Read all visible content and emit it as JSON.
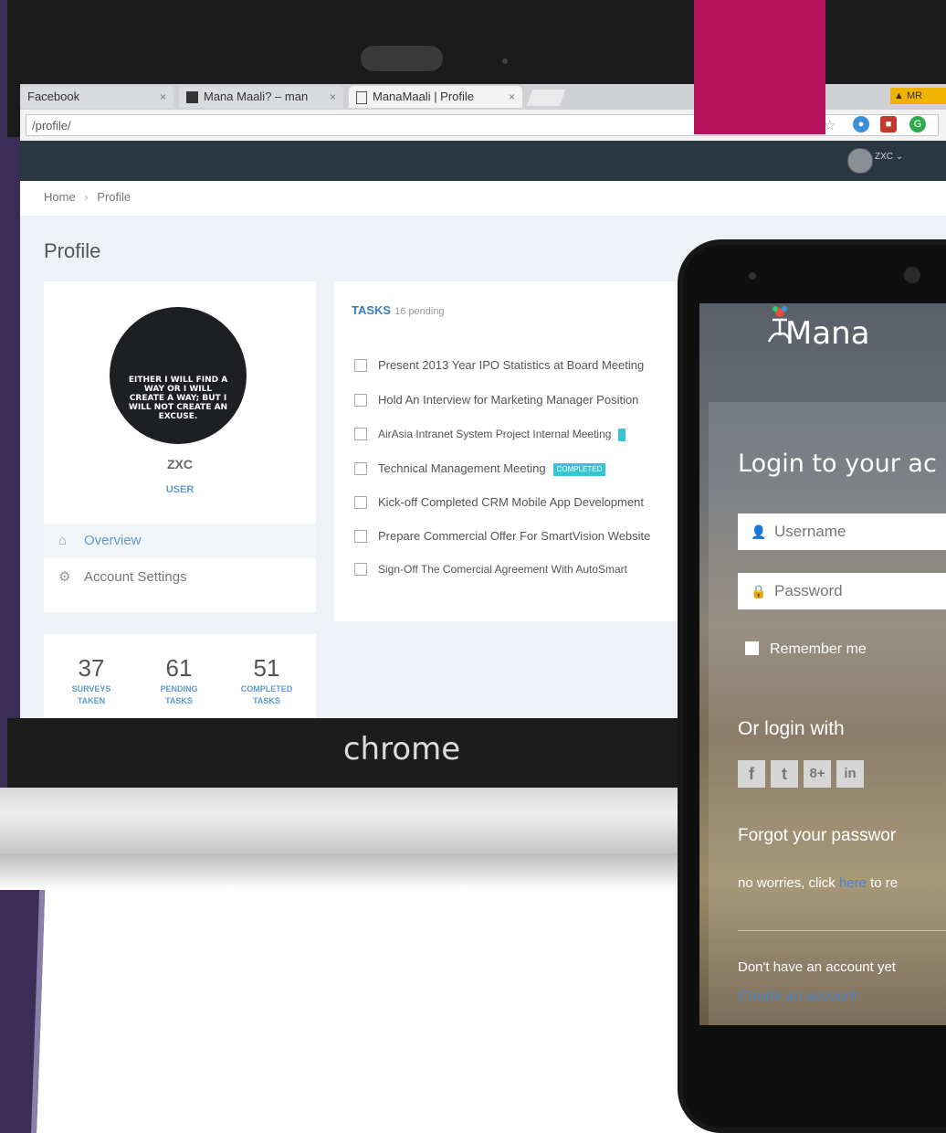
{
  "browser": {
    "tabs": [
      {
        "label": "Facebook",
        "close": "×"
      },
      {
        "label": "Mana Maali? – man",
        "close": "×"
      },
      {
        "label": "ManaMaali | Profile",
        "close": "×"
      }
    ],
    "url": "/profile/",
    "warning_label": "MR"
  },
  "app": {
    "user_menu": "ZXC",
    "breadcrumb": {
      "home": "Home",
      "sep": "›",
      "current": "Profile"
    },
    "page_title": "Profile",
    "profile": {
      "photo_caption": "EITHER I WILL FIND A WAY OR I WILL CREATE A WAY; BUT I WILL NOT CREATE AN EXCUSE.",
      "name": "ZXC",
      "role": "USER",
      "menu": [
        {
          "label": "Overview",
          "icon": "home-icon"
        },
        {
          "label": "Account Settings",
          "icon": "gear-icon"
        }
      ]
    },
    "stats": [
      {
        "value": "37",
        "label1": "SURVEYS",
        "label2": "TAKEN"
      },
      {
        "value": "61",
        "label1": "PENDING",
        "label2": "TASKS"
      },
      {
        "value": "51",
        "label1": "COMPLETED",
        "label2": "TASKS"
      }
    ],
    "tasks": {
      "title": "TASKS",
      "subtitle": "16 pending",
      "items": [
        {
          "label": "Present 2013 Year IPO Statistics at Board Meeting"
        },
        {
          "label": "Hold An Interview for Marketing Manager Position"
        },
        {
          "label": "AirAsia Intranet System Project Internal Meeting"
        },
        {
          "label": "Technical Management Meeting",
          "badge": "COMPLETED"
        },
        {
          "label": "Kick-off Completed CRM Mobile App Development"
        },
        {
          "label": "Prepare Commercial Offer For SmartVision Website"
        },
        {
          "label": "Sign-Off The Comercial Agreement With AutoSmart"
        }
      ]
    }
  },
  "laptop_brand": "chrome",
  "phone": {
    "brand": "Mana",
    "login_title": "Login to your ac",
    "username_placeholder": "Username",
    "password_placeholder": "Password",
    "remember": "Remember me",
    "or_login": "Or login with",
    "social": [
      "f",
      "t",
      "8+",
      "in"
    ],
    "forgot": "Forgot your passwor",
    "no_worries_a": "no worries, click",
    "no_worries_link": "here",
    "no_worries_b": "to re",
    "no_account": "Don't have an account yet",
    "create_account": "Create an account"
  },
  "colors": {
    "accent_pink": "#b5115c",
    "swoosh_purple": "#3b2d55",
    "app_nav": "#2b3643",
    "link_blue": "#5b9bd1",
    "badge_cyan": "#36c6d3"
  }
}
